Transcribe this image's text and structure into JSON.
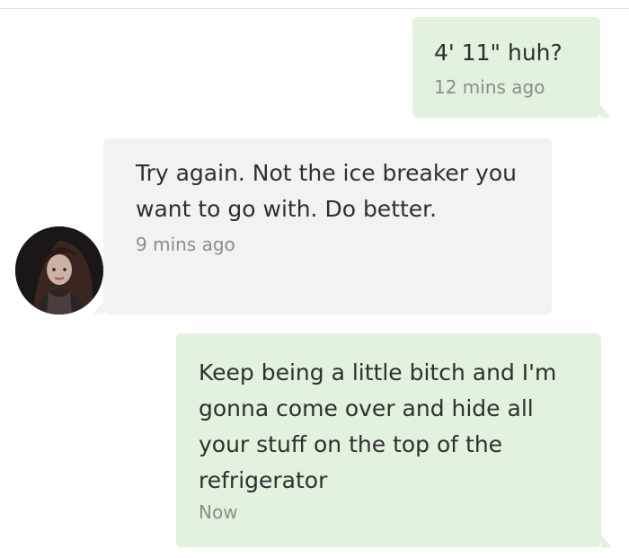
{
  "conversation": {
    "messages": [
      {
        "direction": "sent",
        "text": "4' 11\" huh?",
        "time": "12 mins ago"
      },
      {
        "direction": "received",
        "text": "Try again. Not the ice breaker you want to go with. Do better.",
        "time": "9 mins ago"
      },
      {
        "direction": "sent",
        "text": "Keep being a little bitch and I'm gonna come over and hide all your stuff on the top of the refrigerator",
        "time": "Now"
      }
    ]
  },
  "colors": {
    "sent_bubble": "#e3f1df",
    "received_bubble": "#f2f2f2",
    "message_text": "#2f2f2f",
    "timestamp_text": "#8c8c8c"
  }
}
